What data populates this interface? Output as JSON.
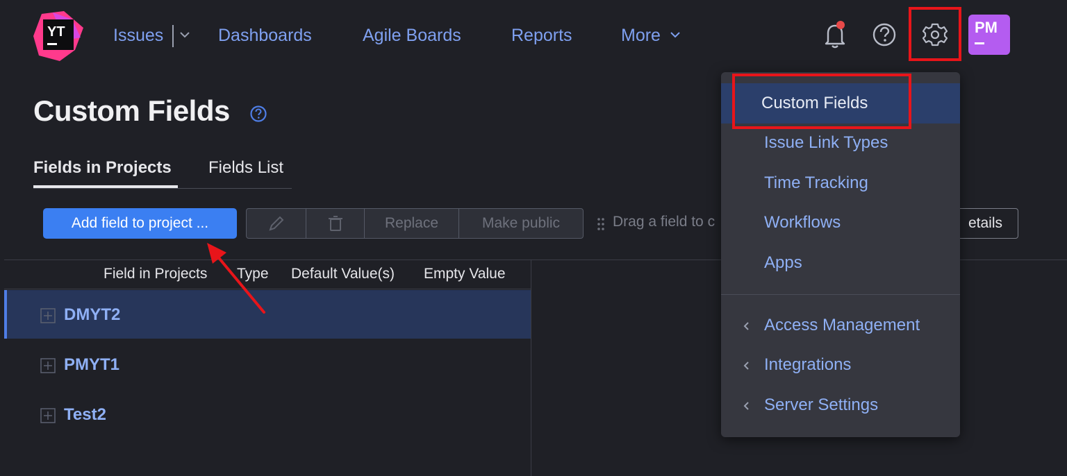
{
  "header": {
    "logo_text": "YT",
    "nav": {
      "issues": "Issues",
      "dashboards": "Dashboards",
      "agile_boards": "Agile Boards",
      "reports": "Reports",
      "more": "More"
    },
    "avatar_initials": "PM",
    "icons": [
      "bell-icon",
      "help-icon",
      "gear-icon"
    ],
    "notification_dot_color": "#e84a4a"
  },
  "page": {
    "title": "Custom Fields",
    "tabs": [
      "Fields in Projects",
      "Fields List"
    ],
    "active_tab": "Fields in Projects"
  },
  "toolbar": {
    "add_field_label": "Add field to project ...",
    "replace_label": "Replace",
    "make_public_label": "Make public",
    "drag_hint": "Drag a field to c",
    "details_label": "etails"
  },
  "table": {
    "columns": [
      "Field in Projects",
      "Type",
      "Default Value(s)",
      "Empty Value"
    ],
    "rows": [
      {
        "name": "DMYT2",
        "selected": true
      },
      {
        "name": "PMYT1",
        "selected": false
      },
      {
        "name": "Test2",
        "selected": false
      }
    ]
  },
  "admin_menu": {
    "items": [
      {
        "label": "Custom Fields",
        "active": true
      },
      {
        "label": "Issue Link Types"
      },
      {
        "label": "Time Tracking"
      },
      {
        "label": "Workflows"
      },
      {
        "label": "Apps"
      }
    ],
    "groups": [
      {
        "label": "Access Management"
      },
      {
        "label": "Integrations"
      },
      {
        "label": "Server Settings"
      }
    ]
  },
  "colors": {
    "accent": "#3b7ff2",
    "link": "#8fb0f5",
    "annotation_red": "#e8151a",
    "avatar": "#b45cf0"
  }
}
